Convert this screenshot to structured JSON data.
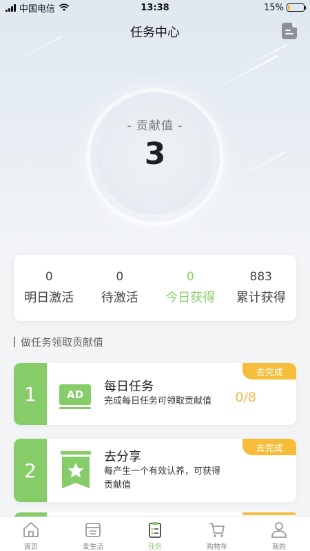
{
  "status_bar": {
    "carrier": "中国电信",
    "time": "13:38",
    "battery": "15%",
    "battery_level": 0.15
  },
  "nav": {
    "title": "任务中心",
    "right_icon": "document-icon"
  },
  "contribution": {
    "label": "- 贡献值 -",
    "value": "3"
  },
  "stats": [
    {
      "value": "0",
      "label": "明日激活"
    },
    {
      "value": "0",
      "label": "待激活"
    },
    {
      "value": "0",
      "label": "今日获得",
      "active": true
    },
    {
      "value": "883",
      "label": "累计获得"
    }
  ],
  "section": {
    "title": "做任务领取贡献值"
  },
  "tasks": [
    {
      "index": "1",
      "icon": "ad-icon",
      "icon_text": "AD",
      "title": "每日任务",
      "desc": "完成每日任务可领取贡献值",
      "progress": "0/8",
      "badge": "去完成"
    },
    {
      "index": "2",
      "icon": "share-star-icon",
      "title": "去分享",
      "desc_line1": "每产生一个有效认养，可获得",
      "desc_line2": "贡献值",
      "badge": "去完成"
    }
  ],
  "tabbar": [
    {
      "label": "首页",
      "icon": "home-icon"
    },
    {
      "label": "爱生活",
      "icon": "love-life-icon"
    },
    {
      "label": "任务",
      "icon": "task-icon",
      "active": true
    },
    {
      "label": "购物车",
      "icon": "cart-icon"
    },
    {
      "label": "我的",
      "icon": "user-icon"
    }
  ],
  "colors": {
    "accent_green": "#86cc68",
    "badge_yellow": "#f6bd3a",
    "progress_orange": "#f2b94a"
  }
}
